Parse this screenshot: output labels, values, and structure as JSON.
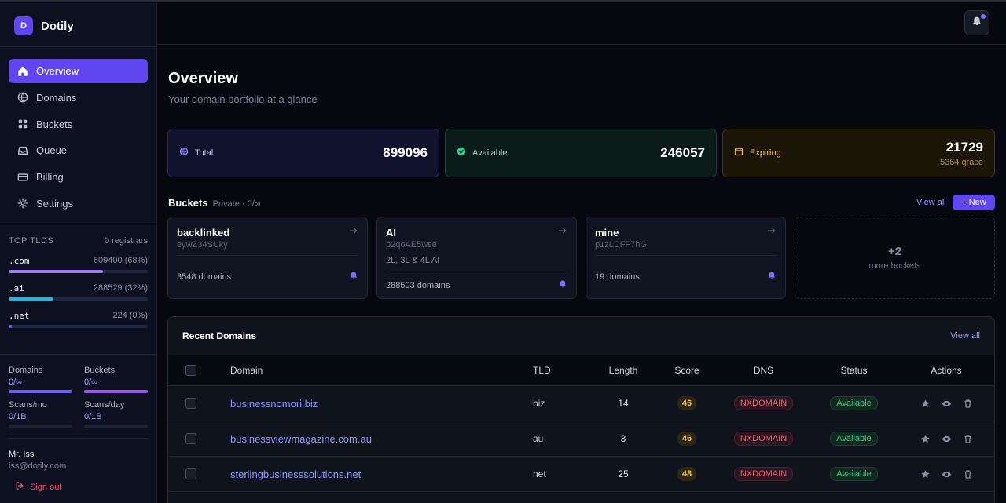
{
  "brand": {
    "logo_letter": "D",
    "name": "Dotily"
  },
  "nav": [
    {
      "label": "Overview",
      "icon": "home-icon",
      "active": true
    },
    {
      "label": "Domains",
      "icon": "globe-icon",
      "active": false
    },
    {
      "label": "Buckets",
      "icon": "grid-icon",
      "active": false
    },
    {
      "label": "Queue",
      "icon": "inbox-icon",
      "active": false
    },
    {
      "label": "Billing",
      "icon": "card-icon",
      "active": false
    },
    {
      "label": "Settings",
      "icon": "gear-icon",
      "active": false
    }
  ],
  "top_tlds": {
    "heading": "TOP TLDS",
    "registrars": "0 registrars",
    "items": [
      {
        "name": ".com",
        "count": "609400 (68%)",
        "share": 0.68,
        "color": "#9b7cf5"
      },
      {
        "name": ".ai",
        "count": "288529 (32%)",
        "share": 0.32,
        "color": "#1ab8e8"
      },
      {
        "name": ".net",
        "count": "224 (0%)",
        "share": 0.0,
        "color": "#6b6bf0"
      }
    ]
  },
  "usage": [
    {
      "label": "Domains",
      "value": "0/∞",
      "fill": 1.0,
      "color": "#6b5cf5"
    },
    {
      "label": "Buckets",
      "value": "0/∞",
      "fill": 1.0,
      "color": "#9a5cf0"
    },
    {
      "label": "Scans/mo",
      "value": "0/1B",
      "fill": 0.0,
      "color": "#6b5cf5"
    },
    {
      "label": "Scans/day",
      "value": "0/1B",
      "fill": 0.0,
      "color": "#6b5cf5"
    }
  ],
  "user": {
    "name": "Mr. Iss",
    "email": "iss@dotily.com",
    "signout": "Sign out"
  },
  "header": {
    "notification_dot_color": "#7e6bff"
  },
  "page": {
    "title": "Overview",
    "subtitle": "Your domain portfolio at a glance"
  },
  "stats": {
    "total": {
      "label": "Total",
      "value": "899096"
    },
    "available": {
      "label": "Available",
      "value": "246057"
    },
    "expiring": {
      "label": "Expiring",
      "value": "21729",
      "sub": "5364 grace"
    }
  },
  "buckets_section": {
    "title": "Buckets",
    "meta": "Private · 0/∞",
    "view_all": "View all",
    "new_label": "+ New",
    "items": [
      {
        "name": "backlinked",
        "id": "eywZ34SUky",
        "desc": "",
        "count": "3548 domains"
      },
      {
        "name": "AI",
        "id": "p2qoAE5wse",
        "desc": "2L, 3L & 4L AI",
        "count": "288503 domains"
      },
      {
        "name": "mine",
        "id": "p1zLDFF7hG",
        "desc": "",
        "count": "19 domains"
      }
    ],
    "more": {
      "count": "+2",
      "label": "more buckets"
    }
  },
  "recent": {
    "title": "Recent Domains",
    "view_all": "View all",
    "columns": [
      "Domain",
      "TLD",
      "Length",
      "Score",
      "DNS",
      "Status",
      "Actions"
    ],
    "rows": [
      {
        "domain": "businessnomori.biz",
        "tld": "biz",
        "length": "14",
        "score": "46",
        "dns": "NXDOMAIN",
        "status": "Available"
      },
      {
        "domain": "businessviewmagazine.com.au",
        "tld": "au",
        "length": "3",
        "score": "46",
        "dns": "NXDOMAIN",
        "status": "Available"
      },
      {
        "domain": "sterlingbusinesssolutions.net",
        "tld": "net",
        "length": "25",
        "score": "48",
        "dns": "NXDOMAIN",
        "status": "Available"
      }
    ]
  }
}
